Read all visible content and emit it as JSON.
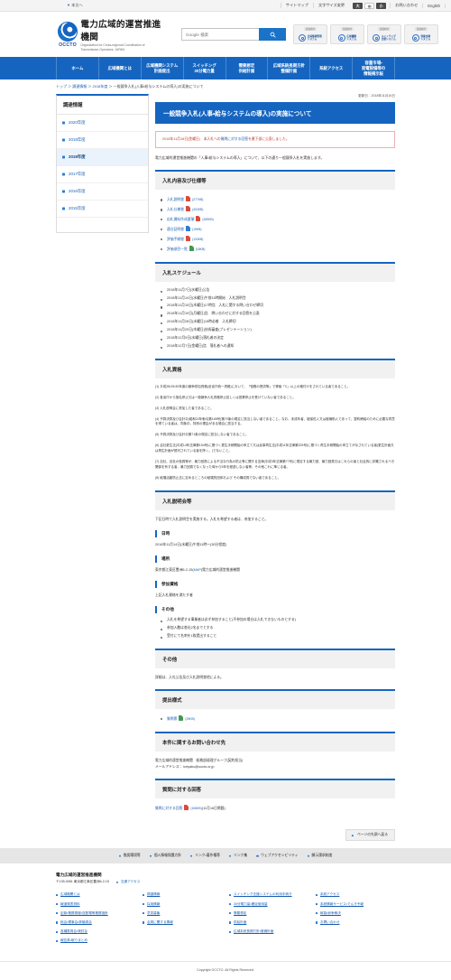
{
  "utilbar": {
    "skip_label": "本文へ",
    "sitemap": "サイトマップ",
    "fontsize_label": "文字サイズ変更",
    "fontsize_options": [
      "大",
      "中",
      "小"
    ],
    "fontsize_selected": "大",
    "contact": "お問い合わせ",
    "english": "English"
  },
  "header": {
    "logo_acronym": "OCCTO",
    "brand_ja": "電力広域的運営推進機関",
    "brand_en_line1": "Organization for Cross-regional Coordination of",
    "brand_en_line2": "Transmission Operators, JAPAN",
    "search_placeholder": "Google 検索",
    "search_icon": "search-icon",
    "system_buttons": [
      {
        "tag": "会員向け",
        "label_line1": "会員情報管理",
        "label_line2": "システム",
        "icon": "gear-icon"
      },
      {
        "tag": "会員向け",
        "label_line1": "広域機関",
        "label_line2": "システム",
        "icon": "gear-icon"
      },
      {
        "tag": "会員向け",
        "label_line1": "スイッチング",
        "label_line2": "支援システム",
        "icon": "gear-icon"
      },
      {
        "tag": "会員向け",
        "label_line1": "容量市場",
        "label_line2": "システム",
        "icon": "gear-icon"
      }
    ]
  },
  "gnav": [
    {
      "line1": "ホーム",
      "line2": ""
    },
    {
      "line1": "広域機関とは",
      "line2": ""
    },
    {
      "line1": "広域機関システム",
      "line2": "計画提出"
    },
    {
      "line1": "スイッチング",
      "line2": "30分電力量"
    },
    {
      "line1": "需要想定",
      "line2": "供給計画"
    },
    {
      "line1": "広域系統長期方針",
      "line2": "整備計画"
    },
    {
      "line1": "系統アクセス",
      "line2": ""
    },
    {
      "line1": "容量市場・",
      "line2": "発電設備等の",
      "line3": "情報掲示板"
    }
  ],
  "breadcrumb": {
    "items": [
      "トップ",
      "調達情報",
      "2018年度",
      "一般競争入札(人事・給与システムの導入)の実施について"
    ],
    "separator": "＞"
  },
  "sidebar": {
    "title": "調達情報",
    "items": [
      {
        "label": "2020年度",
        "active": false
      },
      {
        "label": "2019年度",
        "active": false
      },
      {
        "label": "2018年度",
        "active": true
      },
      {
        "label": "2017年度",
        "active": false
      },
      {
        "label": "2016年度",
        "active": false
      },
      {
        "label": "2015年度",
        "active": false
      }
    ]
  },
  "main": {
    "updated": "更新日：2018年11月16日",
    "page_title": "一般競争入札(人事・給与システムの導入)の実施について",
    "notice": {
      "prefix": "2018年11月16日(金曜日)　本入札への",
      "link": "質問に対する回答",
      "suffix": "を最下部に公表しました。"
    },
    "lead": "電力広域的運営推進機関の「人事・給与システムの導入」について、以下の通り一般競争入札を実施します。",
    "sections": [
      {
        "heading": "入札内容及び仕様等",
        "files": [
          {
            "label": "入札説明書",
            "type": "pdf",
            "size": "(277KB)"
          },
          {
            "label": "入札仕様書",
            "type": "pdf",
            "size": "(402KB)"
          },
          {
            "label": "応札資料作成要領",
            "type": "pdf",
            "size": "(269KB)"
          },
          {
            "label": "適合証明書",
            "type": "doc",
            "size": "(19KB)"
          },
          {
            "label": "評価手順書",
            "type": "pdf",
            "size": "(133KB)"
          },
          {
            "label": "評価項目一覧",
            "type": "xls",
            "size": "(18KB)"
          }
        ]
      },
      {
        "heading": "入札スケジュール",
        "items": [
          "2018年11月7日(水曜日)公告",
          "2018年11月14日(水曜日)午前11時開始　入札説明会",
          "2018年11月15日(木曜日)17時迄　入札に関する問い合わせ締切",
          "2018年11月19日(月曜日)迄　問い合わせに対する回答を公表",
          "2018年11月28日(水曜日)15時必着　入札締切",
          "2018年11月29日(木曜日)技術審査(プレゼンテーション)",
          "2018年12月5日(水曜日)落札者の決定",
          "2018年12月7日(金曜日)迄　落札者への通知"
        ]
      },
      {
        "heading": "入札資格",
        "paragraphs": [
          "(1) 平成28・29・30年度の競争参加資格(全省庁統一資格)において、「役務の提供等」で等級「C」以上の格付けをされている者であること。",
          "(2) 各省庁から指名停止又は一般競争入札資格停止若しくは営業停止を受けていない者であること。",
          "(3) 入札説明会に参加した者であること。",
          "(4) 予算決算及び会計令(昭和22年勅令第165号)第70条の規定に該当しない者であること。なお、未成年者、被保佐人又は被補助人であって、契約締結のために必要な同意を得ている者は、同条中、特別の理由がある場合に該当する。",
          "(5) 予算決算及び会計令第71条の規定に該当しない者であること。",
          "(6) 会社更生法(平成14年法律第154号)に基づく更生手続開始の申立て又は民事再生法(平成11年法律第225号)に基づく再生手続開始の申立てがなされている者(更生計画又は再生計画が認可されている者を除く。)でないこと。",
          "(7) 自社、自社の役員等が、暴力団員による不当な行為の防止等に関する法律(平成3年法律第77号)に規定する暴力団、暴力団員又はこれらの者と社会的に非難されるべき関係を有する者、暴力団員でなくなった時から5年を経過しない者等、その他これに準じる者。",
          "(8) 破壊活動防止法に定めるところの破壊的団体および その構成員でない者であること。"
        ]
      },
      {
        "heading": "入札説明会等",
        "intro": "下記日時で入札説明会を実施する。入札を希望する者は、参加すること。",
        "subs": [
          {
            "title": "日時",
            "text": "2018年11月14日(水曜日)午前11時～(30分程度)"
          },
          {
            "title": "場所",
            "text_prefix": "東京都江東区豊洲6-2-15(",
            "link": "MAP",
            "text_suffix": ")電力広域的運営推進機関"
          },
          {
            "title": "参加資格",
            "text": "上記入札資格を満たす者"
          },
          {
            "title": "その他",
            "bullets": [
              "入札を希望する事業者は必ず参加すること(不参加の場合は入札できないものとする)",
              "参加人数は各社2名までとする",
              "受付にて名刺を1枚提出すること"
            ]
          }
        ]
      },
      {
        "heading": "その他",
        "text": "詳細は、入札公告及び入札説明書他による。"
      },
      {
        "heading": "提出様式",
        "files": [
          {
            "label": "質問票",
            "type": "xls",
            "size": "(25KB)"
          }
        ]
      },
      {
        "heading": "本件に関するお問い合わせ先",
        "lines": [
          "電力広域的運営推進機関　総務部経理グループ(契約担当)",
          "メールアドレス： keiyaku@occto.or.jp"
        ]
      },
      {
        "heading": "質問に対する回答",
        "answer": {
          "link": "質問に対する回答",
          "type": "pdf",
          "size": "(106KB)",
          "note": "(11月16日掲載)"
        }
      }
    ],
    "pagetop": "ページの先頭へ戻る"
  },
  "footer": {
    "nav": [
      "推奨環境等",
      "個人情報保護方針",
      "リンク・著作権等",
      "リンク集",
      "ウェブアクセシビリティ",
      "開示請求制度"
    ],
    "org_name": "電力広域的運営推進機関",
    "address": "〒135-0061 東京都江東区豊洲6-2-15",
    "access_link": "交通アクセス",
    "columns": [
      [
        "広域機関とは",
        "報道発表資料",
        "定款・業務規程・送配電等業務指針",
        "総会・理事会・評議員会",
        "各種委員会・検討会",
        "報告書・取りまとめ"
      ],
      [
        "調達情報",
        "採用情報",
        "意見募集",
        "会員に関する情報"
      ],
      [
        "スイッチング支援システムの利用手続き",
        "30分電力量・確定使用量",
        "需要想定",
        "供給計画",
        "広域系統長期方針・整備計画"
      ],
      [
        "系統アクセス",
        "系統情報サービス・でんき予報",
        "斡旋・紛争解決",
        "お問い合わせ"
      ]
    ],
    "copyright": "Copyright OCCTO. All Rights Reserved."
  }
}
